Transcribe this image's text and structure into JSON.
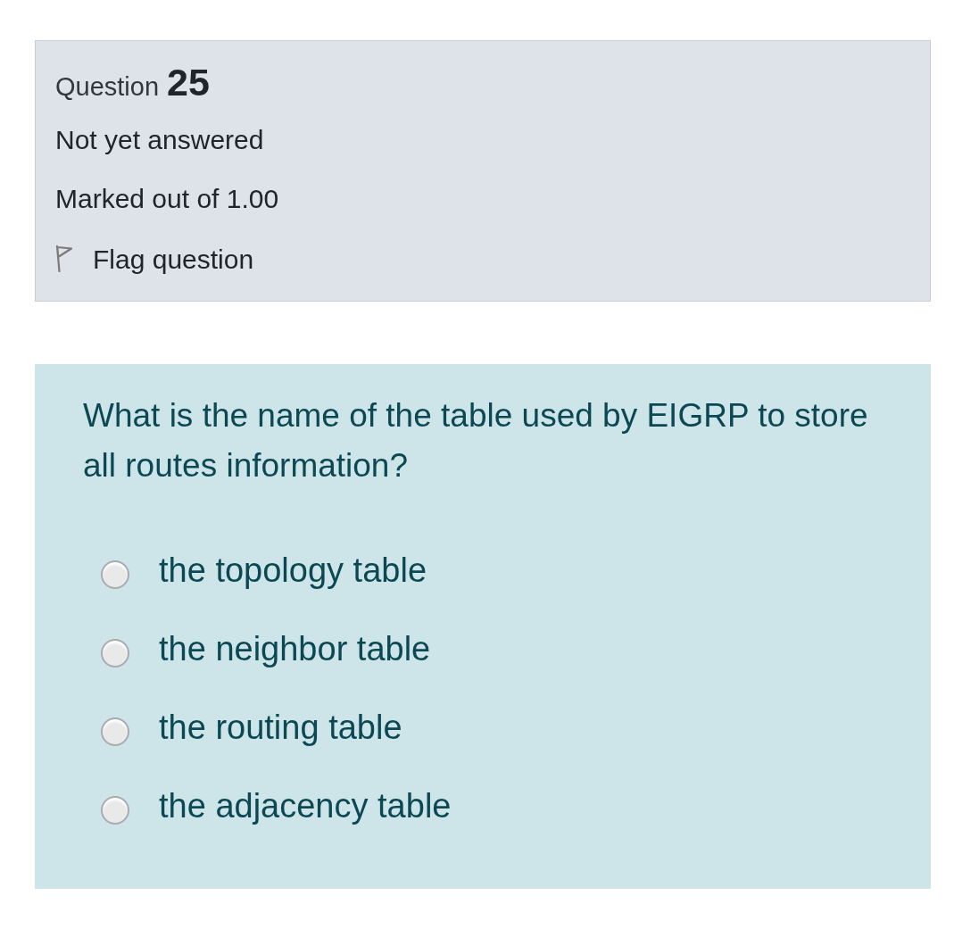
{
  "question_info": {
    "label": "Question",
    "number": "25",
    "status": "Not yet answered",
    "mark": "Marked out of 1.00",
    "flag": {
      "label": "Flag question",
      "flagged": false
    }
  },
  "question": {
    "text": "What is the name of the table used by EIGRP to store all routes information?",
    "options": [
      {
        "label": "the topology table",
        "selected": false
      },
      {
        "label": "the neighbor table",
        "selected": false
      },
      {
        "label": "the routing table",
        "selected": false
      },
      {
        "label": "the adjacency table",
        "selected": false
      }
    ]
  }
}
